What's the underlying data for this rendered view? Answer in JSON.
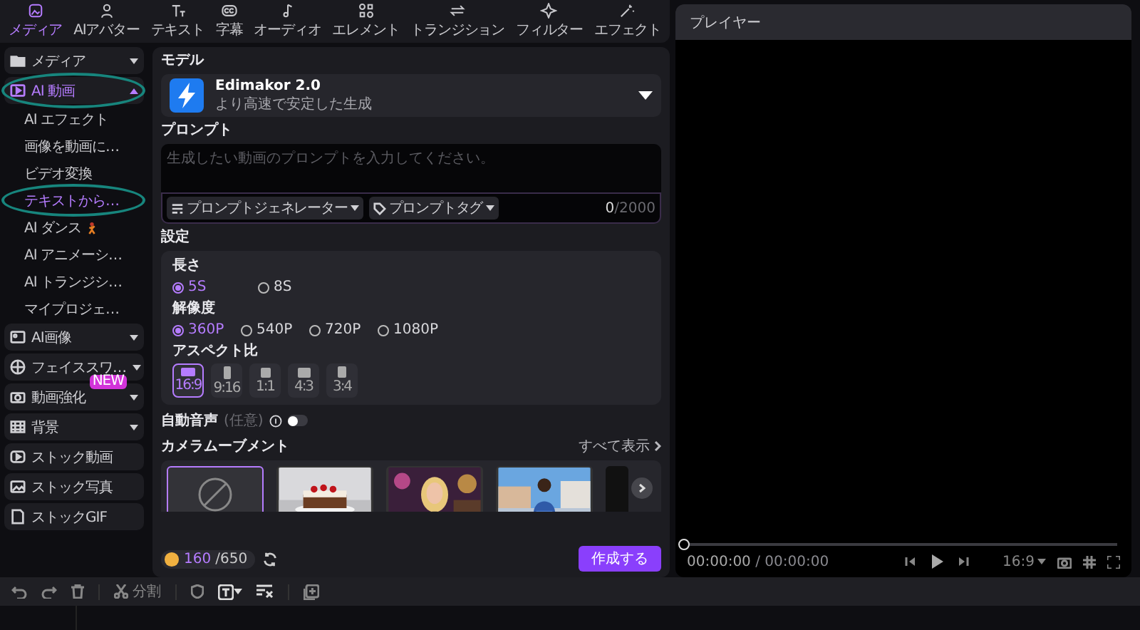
{
  "tabs": [
    {
      "label": "メディア",
      "selected": true
    },
    {
      "label": "AIアバター",
      "selected": false
    },
    {
      "label": "テキスト",
      "selected": false
    },
    {
      "label": "字幕",
      "selected": false
    },
    {
      "label": "オーディオ",
      "selected": false
    },
    {
      "label": "エレメント",
      "selected": false
    },
    {
      "label": "トランジション",
      "selected": false
    },
    {
      "label": "フィルター",
      "selected": false
    },
    {
      "label": "エフェクト",
      "selected": false
    }
  ],
  "sidebar": {
    "items": [
      {
        "label": "メディア",
        "kind": "group",
        "expanded": false,
        "selected": false
      },
      {
        "label": "AI 動画",
        "kind": "group",
        "expanded": true,
        "selected": true,
        "children": [
          {
            "label": "AI エフェクト",
            "kind": "plain",
            "selected": false
          },
          {
            "label": "画像を動画に…",
            "kind": "plain",
            "selected": false
          },
          {
            "label": "ビデオ変換",
            "kind": "plain",
            "selected": false
          },
          {
            "label": "テキストから…",
            "kind": "plain",
            "selected": true
          },
          {
            "label": "AI ダンス",
            "kind": "icon",
            "selected": false
          },
          {
            "label": "AI アニメーシ…",
            "kind": "plain",
            "selected": false
          },
          {
            "label": "AI トランジシ…",
            "kind": "plain",
            "selected": false
          },
          {
            "label": "マイプロジェ…",
            "kind": "plain",
            "selected": false
          }
        ]
      },
      {
        "label": "AI画像",
        "kind": "group",
        "expanded": false,
        "selected": false
      },
      {
        "label": "フェイススワ…",
        "kind": "group",
        "expanded": false,
        "selected": false
      },
      {
        "label": "動画強化",
        "kind": "group",
        "expanded": false,
        "selected": false,
        "badge": "NEW"
      },
      {
        "label": "背景",
        "kind": "group",
        "expanded": false,
        "selected": false
      },
      {
        "label": "ストック動画",
        "kind": "link",
        "selected": false
      },
      {
        "label": "ストック写真",
        "kind": "link",
        "selected": false
      },
      {
        "label": "ストックGIF",
        "kind": "link",
        "selected": false
      }
    ]
  },
  "model": {
    "label": "モデル",
    "name": "Edimakor 2.0",
    "description": "より高速で安定した生成"
  },
  "prompt": {
    "label": "プロンプト",
    "placeholder": "生成したい動画のプロンプトを入力してください。",
    "buttons": [
      "プロンプトジェネレーター",
      "プロンプトタグ"
    ],
    "count": "0",
    "limit": "/2000"
  },
  "settings": {
    "label": "設定",
    "groups": [
      {
        "label": "長さ",
        "kind": "radio",
        "options": [
          {
            "label": "5S",
            "selected": true
          },
          {
            "label": "8S",
            "selected": false
          }
        ]
      },
      {
        "label": "解像度",
        "kind": "radio",
        "options": [
          {
            "label": "360P",
            "selected": true
          },
          {
            "label": "540P",
            "selected": false
          },
          {
            "label": "720P",
            "selected": false
          },
          {
            "label": "1080P",
            "selected": false
          }
        ]
      },
      {
        "label": "アスペクト比",
        "kind": "aspect",
        "options": [
          {
            "label": "16:9",
            "selected": true
          },
          {
            "label": "9:16",
            "selected": false
          },
          {
            "label": "1:1",
            "selected": false
          },
          {
            "label": "4:3",
            "selected": false
          },
          {
            "label": "3:4",
            "selected": false
          }
        ]
      }
    ]
  },
  "auto_audio": {
    "label": "自動音声",
    "note": "(任意)",
    "on": false
  },
  "camera": {
    "label": "カメラムーブメント",
    "see_all": "すべて表示",
    "options": [
      {
        "kind": "none",
        "selected": true
      },
      {
        "kind": "picture",
        "selected": false
      },
      {
        "kind": "picture",
        "selected": false
      },
      {
        "kind": "picture",
        "selected": false
      },
      {
        "kind": "blank",
        "selected": false
      }
    ]
  },
  "footer": {
    "credits": "160",
    "credit_total": "/650",
    "create": "作成する"
  },
  "player": {
    "title": "プレイヤー",
    "level": 0,
    "time": "00:00:00",
    "total": " / 00:00:00",
    "ratio": "16:9"
  },
  "toolbar": {
    "split": "分割"
  }
}
